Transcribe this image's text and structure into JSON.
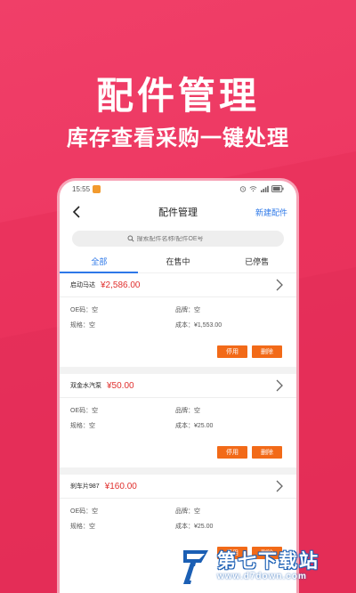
{
  "hero": {
    "title": "配件管理",
    "subtitle": "库存查看采购一键处理"
  },
  "status_bar": {
    "time": "15:55",
    "icons": [
      "alarm-icon",
      "wifi-icon",
      "signal-icon",
      "battery-icon"
    ]
  },
  "header": {
    "title": "配件管理",
    "action_label": "新建配件",
    "back_icon": "back-arrow-icon"
  },
  "search": {
    "placeholder": "搜索配件名称/配件OE号"
  },
  "tabs": [
    {
      "label": "全部",
      "active": true
    },
    {
      "label": "在售中",
      "active": false
    },
    {
      "label": "已停售",
      "active": false
    }
  ],
  "parts": [
    {
      "name": "启动马达",
      "price": "¥2,586.00",
      "oe_label": "OE码：空",
      "brand_label": "品牌：空",
      "spec_label": "规格：空",
      "cost_label": "成本：¥1,553.00",
      "btn_disable": "停用",
      "btn_delete": "删除"
    },
    {
      "name": "双金水汽泵",
      "price": "¥50.00",
      "oe_label": "OE码：空",
      "brand_label": "品牌：空",
      "spec_label": "规格：空",
      "cost_label": "成本：¥25.00",
      "btn_disable": "停用",
      "btn_delete": "删除"
    },
    {
      "name": "刹车片987",
      "price": "¥160.00",
      "oe_label": "OE码：空",
      "brand_label": "品牌：空",
      "spec_label": "规格：空",
      "cost_label": "成本：¥25.00",
      "btn_disable": "停用",
      "btn_delete": "删除"
    }
  ],
  "watermark": {
    "brand": "第七下载站",
    "url": "www.d7down.com"
  },
  "colors": {
    "background": "#ec3560",
    "accent_blue": "#2d78e8",
    "price_red": "#e0302e",
    "button_orange": "#f26a18"
  }
}
